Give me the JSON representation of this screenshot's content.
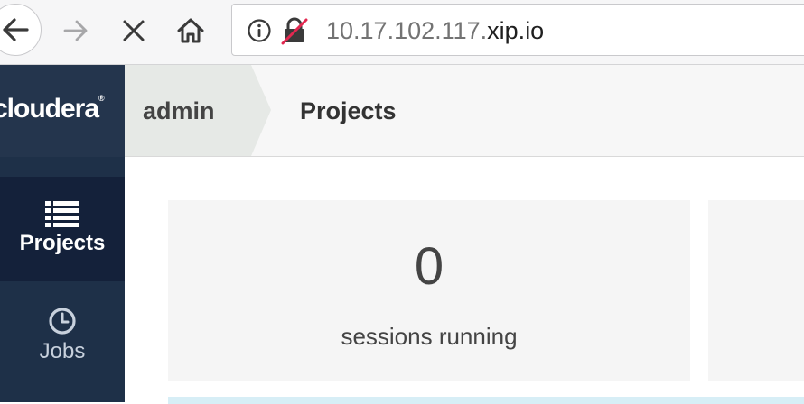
{
  "browser": {
    "url_prefix": "10.17.102.117.",
    "url_domain": "xip.io"
  },
  "sidebar": {
    "brand": "cloudera",
    "items": [
      {
        "label": "Projects",
        "icon": "list-icon",
        "active": true
      },
      {
        "label": "Jobs",
        "icon": "clock-icon",
        "active": false
      }
    ]
  },
  "breadcrumb": {
    "parent": "admin",
    "current": "Projects"
  },
  "stats": {
    "sessions_running_value": "0",
    "sessions_running_label": "sessions running"
  },
  "colors": {
    "sidebar_bg": "#1e3048",
    "sidebar_active_bg": "#14213a",
    "card_bg": "#f5f5f5",
    "insecure_red": "#e22850"
  }
}
